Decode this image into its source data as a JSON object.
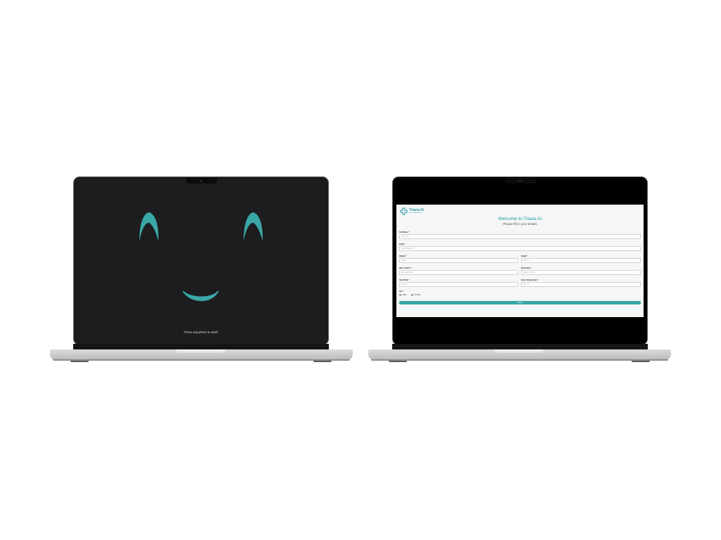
{
  "left_screen": {
    "prompt": "Press anywhere to start!",
    "face_color": "#3aa6a6"
  },
  "right_screen": {
    "logo": {
      "name": "Triana AI",
      "tagline": "your health assistant"
    },
    "title": "Welcome to Triana AI",
    "subtitle": "Please fill in your details",
    "form": {
      "full_name": {
        "label": "Full Name *",
        "placeholder": "John Doe"
      },
      "email": {
        "label": "Email *",
        "placeholder": "you@email.com"
      },
      "weight": {
        "label": "Weight *",
        "placeholder": "70 kg"
      },
      "height": {
        "label": "Height *",
        "placeholder": "170 cm"
      },
      "dob": {
        "label": "Date of Birth *",
        "placeholder": "Select Date"
      },
      "nationality": {
        "label": "Nationality *",
        "placeholder": "Select country"
      },
      "heart_rate": {
        "label": "Heart Rate *",
        "placeholder": "75 bpm"
      },
      "body_temp": {
        "label": "Body Temperature *",
        "placeholder": "37.5 °C"
      },
      "sex": {
        "label": "Sex *",
        "options": [
          "Male",
          "Female"
        ]
      },
      "submit_label": "Submit"
    },
    "accent_color": "#1e9aa2"
  }
}
